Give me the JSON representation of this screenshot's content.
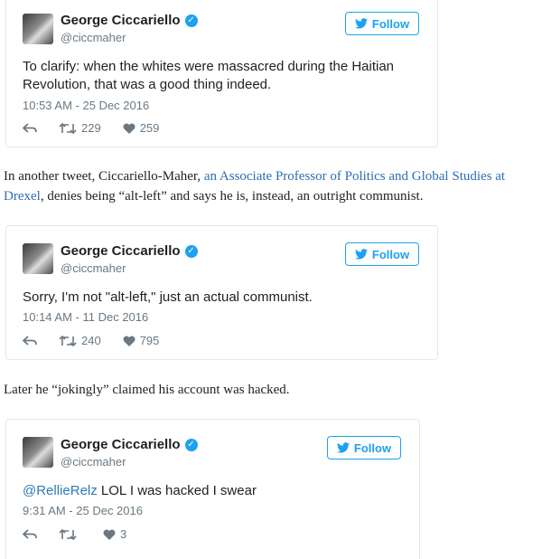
{
  "tweets": [
    {
      "display_name": "George Ciccariello",
      "handle": "@ciccmaher",
      "follow_label": "Follow",
      "text": "To clarify: when the whites were massacred during the Haitian Revolution, that was a good thing indeed.",
      "timestamp": "10:53 AM - 25 Dec 2016",
      "retweets": "229",
      "likes": "259"
    },
    {
      "display_name": "George Ciccariello",
      "handle": "@ciccmaher",
      "follow_label": "Follow",
      "text": "Sorry, I'm not \"alt-left,\" just an actual communist.",
      "timestamp": "10:14 AM - 11 Dec 2016",
      "retweets": "240",
      "likes": "795"
    },
    {
      "display_name": "George Ciccariello",
      "handle": "@ciccmaher",
      "follow_label": "Follow",
      "mention": "@RellieRelz",
      "text": " LOL I was hacked I swear",
      "timestamp": "9:31 AM - 25 Dec 2016",
      "retweets": "",
      "likes": "3"
    }
  ],
  "paragraph1": {
    "before": "In another tweet, Ciccariello-Maher, ",
    "link": "an Associate Professor of Politics and Global Studies at Drexel",
    "after": ", denies being “alt-left” and says he is, instead, an outright communist."
  },
  "paragraph2": "Later he “jokingly” claimed his account was hacked.",
  "colors": {
    "twitter_blue": "#1da1f2",
    "link": "#2e6db4",
    "muted": "#697882"
  },
  "icons": [
    "verified-badge-icon",
    "bird-icon",
    "reply-icon",
    "retweet-icon",
    "heart-icon"
  ]
}
